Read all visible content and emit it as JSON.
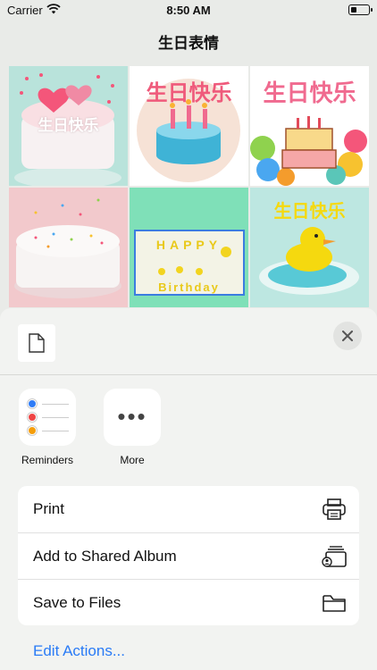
{
  "status": {
    "carrier": "Carrier",
    "time": "8:50 AM",
    "battery_level": 0.25
  },
  "nav": {
    "title": "生日表情"
  },
  "grid": {
    "tiles": [
      {
        "text": "生日快乐"
      },
      {
        "text": "生日快乐"
      },
      {
        "text": "生日快乐"
      },
      {
        "text": ""
      },
      {
        "text_line1": "HAPPY",
        "text_line2": "Birthday"
      },
      {
        "text": "生日快乐"
      }
    ]
  },
  "sheet": {
    "apps": [
      {
        "label": "Reminders",
        "icon": "reminders-icon"
      },
      {
        "label": "More",
        "icon": "more-icon"
      }
    ],
    "actions": [
      {
        "label": "Print",
        "icon": "printer-icon"
      },
      {
        "label": "Add to Shared Album",
        "icon": "shared-album-icon"
      },
      {
        "label": "Save to Files",
        "icon": "folder-icon"
      }
    ],
    "edit_actions": "Edit Actions...",
    "colors": {
      "link": "#2a7bf6",
      "reminder_dots": [
        "#2f7cf6",
        "#ef4444",
        "#f59e0b"
      ]
    }
  }
}
